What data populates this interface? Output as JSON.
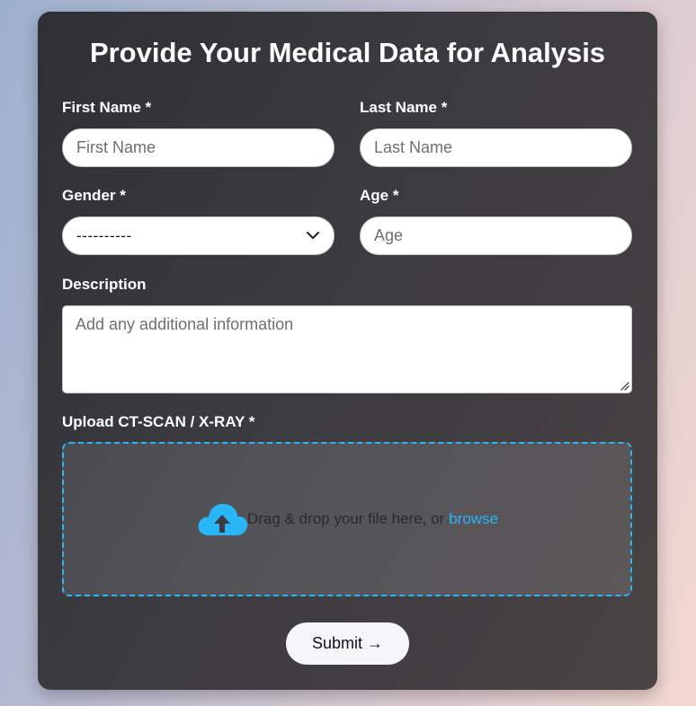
{
  "form": {
    "title": "Provide Your Medical Data for Analysis",
    "first_name": {
      "label": "First Name *",
      "placeholder": "First Name",
      "value": ""
    },
    "last_name": {
      "label": "Last Name *",
      "placeholder": "Last Name",
      "value": ""
    },
    "gender": {
      "label": "Gender *",
      "selected": "----------"
    },
    "age": {
      "label": "Age *",
      "placeholder": "Age",
      "value": ""
    },
    "description": {
      "label": "Description",
      "placeholder": "Add any additional information",
      "value": ""
    },
    "upload": {
      "label": "Upload CT-SCAN / X-RAY *",
      "prompt": "Drag & drop your file here, or",
      "browse": "browse",
      "icon": "cloud-upload-icon"
    },
    "submit_label": "Submit →"
  },
  "colors": {
    "accent": "#29b6f6",
    "card_background": "#3a3a3f",
    "label_text": "#ffffff"
  }
}
